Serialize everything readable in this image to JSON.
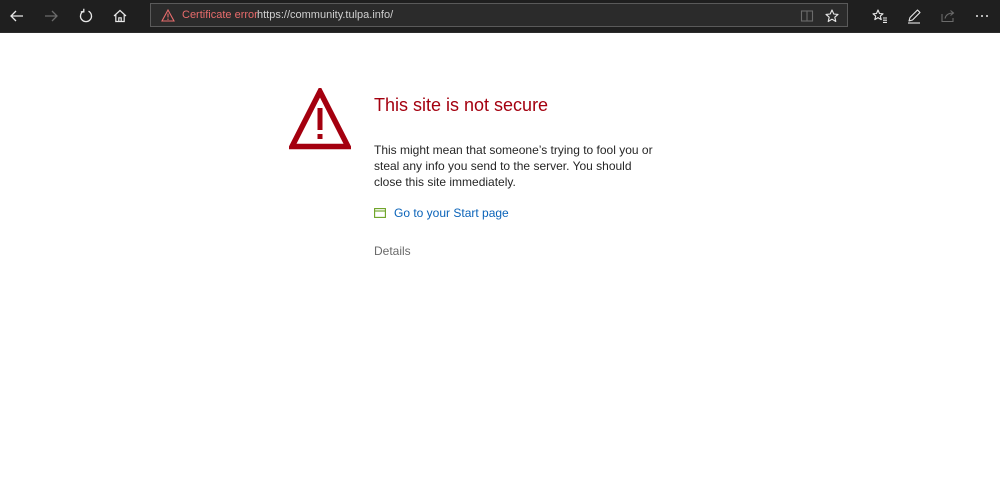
{
  "address_bar": {
    "security_label": "Certificate error",
    "url": "https://community.tulpa.info/"
  },
  "error_page": {
    "title": "This site is not secure",
    "body": "This might mean that someone’s trying to fool you or steal any info you send to the server. You should close this site immediately.",
    "start_link_label": "Go to your Start page",
    "details_label": "Details"
  },
  "colors": {
    "toolbar_bg": "#1f1f1f",
    "title_red": "#a4000f",
    "link_blue": "#0a63b9",
    "cert_error_red": "#e86c6c",
    "start_icon_green": "#6aa121"
  },
  "icons": {
    "toolbar": [
      "back-arrow-icon",
      "forward-arrow-icon",
      "refresh-icon",
      "home-icon"
    ],
    "address_bar": [
      "warning-icon",
      "reading-view-icon",
      "favorite-star-icon"
    ],
    "right_toolbar": [
      "favorites-hub-icon",
      "web-note-pen-icon",
      "share-icon"
    ],
    "page": [
      "warning-triangle-icon",
      "start-page-icon"
    ]
  }
}
